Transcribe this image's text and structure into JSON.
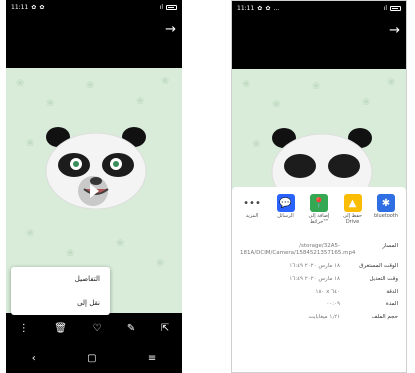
{
  "left": {
    "status": {
      "time": "11:11",
      "icons": [
        "✿",
        "✿"
      ]
    },
    "menu": {
      "details": "التفاصيل",
      "move_to": "نقل إلى"
    },
    "actions": [
      "⋮",
      "🗑",
      "♡",
      "✎",
      "⇱"
    ],
    "nav": [
      "‹",
      "▢",
      "≡"
    ]
  },
  "right": {
    "status": {
      "time": "11:11",
      "icons": [
        "✿",
        "✿",
        "…"
      ]
    },
    "apps": [
      {
        "label": "المزيد",
        "icon": "•••"
      },
      {
        "label": "الرسائل",
        "icon": "💬"
      },
      {
        "label": "إضافة إلى \"خرائط\"",
        "icon": "📍"
      },
      {
        "label": "حفظ إلى Drive",
        "icon": "▲"
      },
      {
        "label": "bluetooth",
        "icon": "✱"
      }
    ],
    "rows": [
      {
        "label": "المسار",
        "value": "/storage/32A5-181A/DCIM/Camera/1584521357165.mp4"
      },
      {
        "label": "الوقت المستغرق",
        "value": "١٨ مارس ٢٠٢٠ ١٦:٤٩"
      },
      {
        "label": "وقت التعديل",
        "value": "١٨ مارس ٢٠٢٠ ١٦:٤٩"
      },
      {
        "label": "الدقة",
        "value": "١٨٠ x ٦٤٠"
      },
      {
        "label": "المدة",
        "value": "٠٠:٠٩"
      },
      {
        "label": "حجم الملف",
        "value": "١٫٢١ ميغابايت"
      }
    ]
  },
  "colors": {
    "photo_bg": "#d8ecd9",
    "blue": "#1a73e8",
    "msg": "#2962ff",
    "maps": "#34a853",
    "drive": "#fbbc04",
    "bt": "#2f6fe3"
  }
}
